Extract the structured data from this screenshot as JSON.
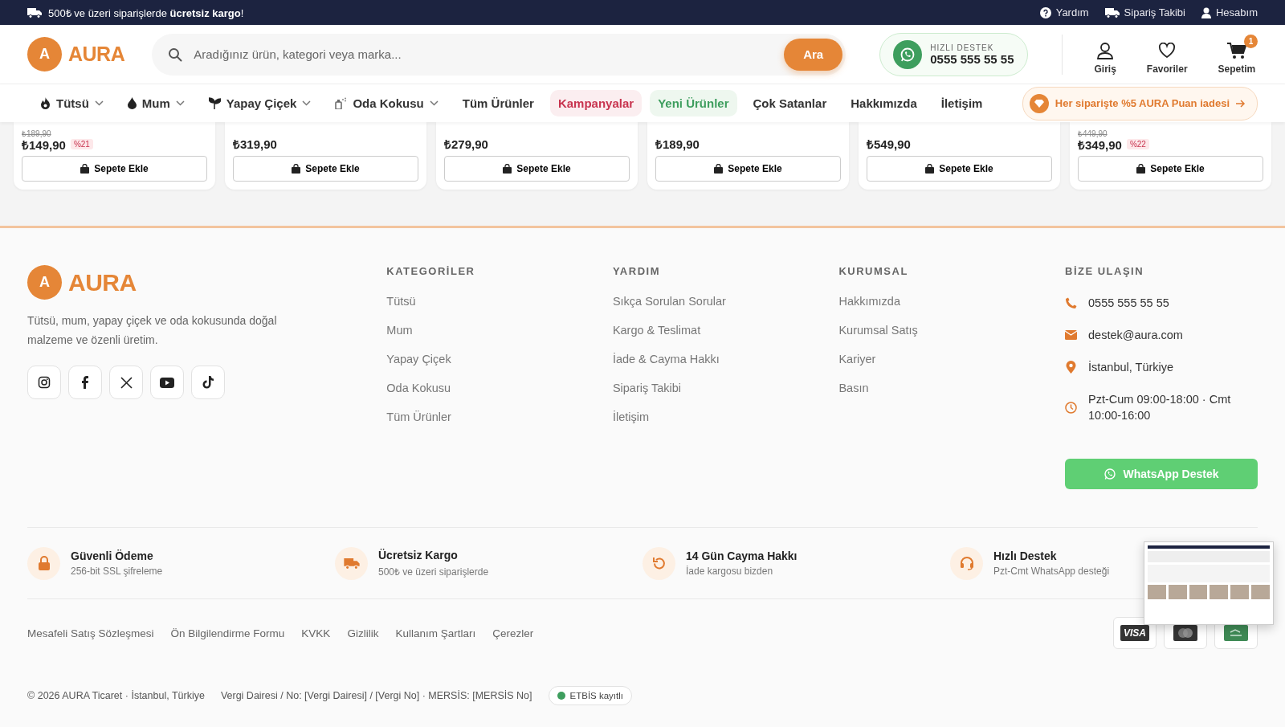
{
  "topbar": {
    "promo": "500₺ ve üzeri siparişlerde **ücretsiz kargo**!",
    "links": [
      {
        "label": "Yardım"
      },
      {
        "label": "Sipariş Takibi"
      },
      {
        "label": "Hesabım"
      }
    ]
  },
  "header": {
    "logo_letter": "A",
    "logo_text": "AURA",
    "search": {
      "placeholder": "Aradığınız ürün, kategori veya marka...",
      "button": "Ara"
    },
    "support": {
      "label": "HIZLI DESTEK",
      "phone": "0555 555 55 55"
    },
    "actions": [
      {
        "label": "Giriş"
      },
      {
        "label": "Favoriler"
      },
      {
        "label": "Sepetim",
        "badge": "1"
      }
    ]
  },
  "nav": {
    "items": [
      {
        "kind": "category",
        "label": "Tütsü"
      },
      {
        "kind": "category",
        "label": "Mum"
      },
      {
        "kind": "category",
        "label": "Yapay Çiçek"
      },
      {
        "kind": "category",
        "label": "Oda Kokusu"
      },
      {
        "kind": "link",
        "label": "Tüm Ürünler"
      },
      {
        "kind": "campaign",
        "label": "Kampanyalar"
      },
      {
        "kind": "new",
        "label": "Yeni Ürünler"
      },
      {
        "kind": "link",
        "label": "Çok Satanlar"
      },
      {
        "kind": "link",
        "label": "Hakkımızda"
      },
      {
        "kind": "link",
        "label": "İletişim"
      }
    ],
    "promo": "Her siparişte %5 AURA Puan iadesi"
  },
  "products": [
    {
      "old_price": "₺189,90",
      "price": "₺149,90",
      "discount": "%21",
      "button": "Sepete Ekle"
    },
    {
      "price": "₺319,90",
      "button": "Sepete Ekle"
    },
    {
      "price": "₺279,90",
      "button": "Sepete Ekle"
    },
    {
      "price": "₺189,90",
      "button": "Sepete Ekle"
    },
    {
      "price": "₺549,90",
      "button": "Sepete Ekle"
    },
    {
      "old_price": "₺449,90",
      "price": "₺349,90",
      "discount": "%22",
      "button": "Sepete Ekle"
    }
  ],
  "footer": {
    "logo_letter": "A",
    "logo_text": "AURA",
    "description": "Tütsü, mum, yapay çiçek ve oda kokusunda doğal malzeme ve özenli üretim.",
    "columns": [
      {
        "title": "KATEGORİLER",
        "links": [
          "Tütsü",
          "Mum",
          "Yapay Çiçek",
          "Oda Kokusu",
          "Tüm Ürünler"
        ]
      },
      {
        "title": "YARDIM",
        "links": [
          "Sıkça Sorulan Sorular",
          "Kargo & Teslimat",
          "İade & Cayma Hakkı",
          "Sipariş Takibi",
          "İletişim"
        ]
      },
      {
        "title": "KURUMSAL",
        "links": [
          "Hakkımızda",
          "Kurumsal Satış",
          "Kariyer",
          "Basın"
        ]
      }
    ],
    "contact": {
      "title": "BİZE ULAŞIN",
      "items": [
        {
          "text": "0555 555 55 55"
        },
        {
          "text": "destek@aura.com"
        },
        {
          "text": "İstanbul, Türkiye"
        },
        {
          "text": "Pzt-Cum 09:00-18:00 · Cmt 10:00-16:00"
        }
      ],
      "button": "WhatsApp Destek"
    },
    "features": [
      {
        "title": "Güvenli Ödeme",
        "subtitle": "256-bit SSL şifreleme"
      },
      {
        "title": "Ücretsiz Kargo",
        "subtitle": "500₺ ve üzeri siparişlerde"
      },
      {
        "title": "14 Gün Cayma Hakkı",
        "subtitle": "İade kargosu bizden"
      },
      {
        "title": "Hızlı Destek",
        "subtitle": "Pzt-Cmt WhatsApp desteği"
      }
    ],
    "legal_links": [
      "Mesafeli Satış Sözleşmesi",
      "Ön Bilgilendirme Formu",
      "KVKK",
      "Gizlilik",
      "Kullanım Şartları",
      "Çerezler"
    ],
    "visa_label": "VISA",
    "copyright": "© 2026 AURA Ticaret · İstanbul, Türkiye",
    "tax": "Vergi Dairesi / No: [Vergi Dairesi] / [Vergi No] · MERSİS: [MERSİS No]",
    "etbis": "ETBİS kayıtlı"
  }
}
